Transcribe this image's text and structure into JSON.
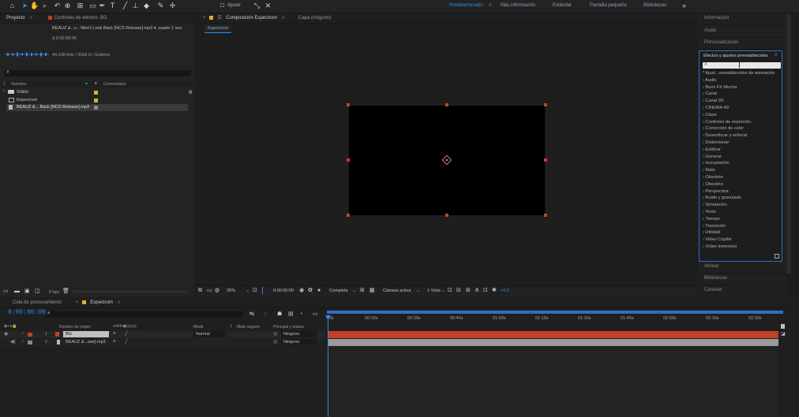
{
  "toolbar": {
    "ajuste_label": "Ajuste",
    "workspaces": [
      "Predeterminado",
      "Más información",
      "Estándar",
      "Pantalla pequeña",
      "Bibliotecas"
    ],
    "more": "»"
  },
  "project": {
    "tab": "Proyecto",
    "tab2": "Controles de efectos: BG",
    "file_name": "BEAUZ &...o - Won't Look Back [NCS Release].mp3",
    "file_used": ", usado 1 vez",
    "duration": "Δ 0:02:58:06",
    "audio_info": "44,100 kHz / 32bit U / Estéreo",
    "search_placeholder": "",
    "col_name": "Nombre",
    "col_comment": "Comentario",
    "items": [
      {
        "name": "Sólido",
        "type": "folder",
        "color": "#d6b22c"
      },
      {
        "name": "Espectrum",
        "type": "comp",
        "color": "#d6b22c"
      },
      {
        "name": "BEAUZ &... Back [NCS Release].mp3",
        "type": "audio",
        "color": "#8a8a8a"
      }
    ],
    "bpc": "8 bpc"
  },
  "composition": {
    "tab": "Composición Espectrum",
    "tab_layer": "Capa (ninguno)",
    "subtab": "Espectrum",
    "zoom": "25%",
    "time": "0:00:00:00",
    "resolution": "Completa",
    "camera": "Cámara activa",
    "views": "1 Vista",
    "exposure": "+0,0"
  },
  "right": {
    "info": "Información",
    "audio": "Audio",
    "preview": "Previsualización",
    "effects_title": "Efectos y ajustes preestablecidos",
    "effects": [
      "* Ajust...reestablecidos de animación",
      "Audio",
      "Boris FX Mocha",
      "Canal",
      "Canal 3D",
      "CINEMA 4D",
      "Clave",
      "Controles de expresión",
      "Corrección de color",
      "Desenfocar y enfocar",
      "Distorsionar",
      "Estilizar",
      "Generar",
      "Incrustación",
      "Mate",
      "Obsolete",
      "Obsoleto",
      "Perspectiva",
      "Ruido y granulado",
      "Simulación",
      "Texto",
      "Tiempo",
      "Transición",
      "Utilidad",
      "Video Copilot",
      "Vídeo inmersivo"
    ],
    "align": "Alinear",
    "libraries": "Bibliotecas",
    "character": "Carácter"
  },
  "timeline": {
    "tab_render": "Cola de procesamiento",
    "tab_comp": "Espectrum",
    "time": "0:00:00:00",
    "col_source": "Nombre de origen",
    "col_mode": "Modo",
    "col_t": "T",
    "col_track": "Mate seguim.",
    "col_parent": "Principal y enlace",
    "layers": [
      {
        "num": "1",
        "name": "BG",
        "mode": "Normal",
        "parent": "Ninguno",
        "color": "#c0402a"
      },
      {
        "num": "2",
        "name": "BEAUZ &...ase].mp3",
        "mode": "",
        "parent": "Ninguno",
        "color": "#8a8a8a"
      }
    ],
    "ticks": [
      "0s",
      "00:15s",
      "00:30s",
      "00:45s",
      "01:00s",
      "01:15s",
      "01:30s",
      "01:45s",
      "02:00s",
      "02:15s",
      "02:30s"
    ]
  },
  "colors": {
    "accent": "#2d8ceb",
    "layer_red": "#c0402a",
    "audio_track": "#9a9a9a",
    "handle": "#c9402a"
  }
}
